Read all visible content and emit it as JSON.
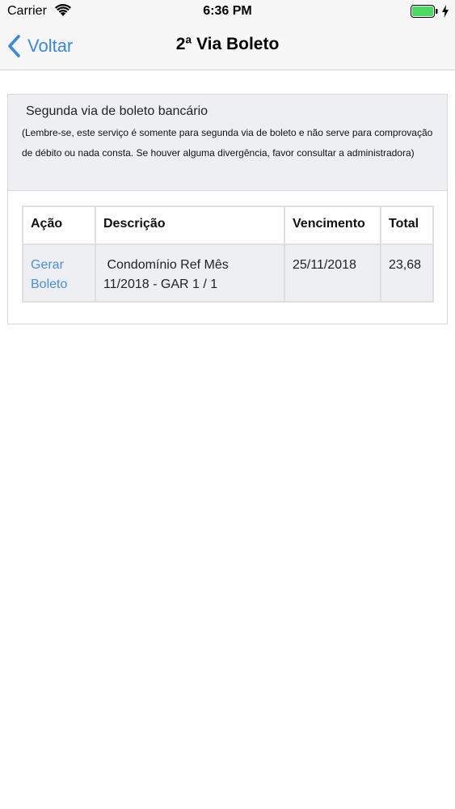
{
  "status_bar": {
    "carrier": "Carrier",
    "time": "6:36 PM",
    "battery_color": "#4cd964"
  },
  "nav": {
    "back_label": "Voltar",
    "title": "2ª Via Boleto",
    "accent_color": "#3b88e0"
  },
  "panel": {
    "title": "Segunda via de boleto bancário",
    "note": "(Lembre-se, este serviço é somente para segunda via de boleto e não serve para comprovação de débito ou nada consta. Se houver alguma divergência, favor consultar a administradora)"
  },
  "table": {
    "headers": [
      "Ação",
      "Descrição",
      "Vencimento",
      "Total"
    ],
    "rows": [
      {
        "action": "Gerar Boleto",
        "description": " Condomínio Ref Mês 11/2018 - GAR 1 / 1",
        "due_date": "25/11/2018",
        "total": "23,68"
      }
    ]
  }
}
